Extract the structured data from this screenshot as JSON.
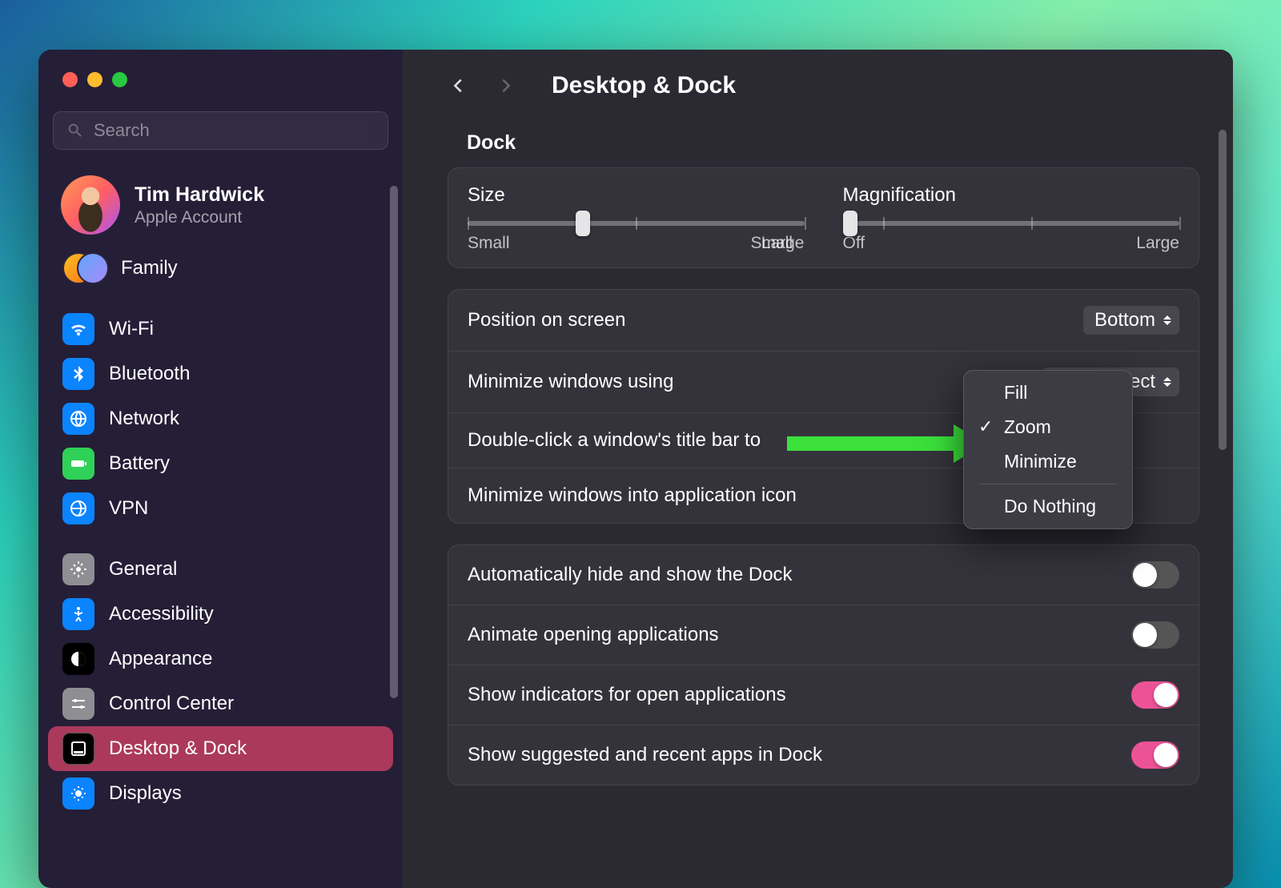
{
  "window": {
    "title": "Desktop & Dock",
    "search_placeholder": "Search"
  },
  "account": {
    "name": "Tim Hardwick",
    "subtitle": "Apple Account",
    "family_label": "Family"
  },
  "sidebar_groups": [
    {
      "items": [
        {
          "key": "wifi",
          "label": "Wi-Fi",
          "icon": "wifi"
        },
        {
          "key": "bluetooth",
          "label": "Bluetooth",
          "icon": "bt"
        },
        {
          "key": "network",
          "label": "Network",
          "icon": "net"
        },
        {
          "key": "battery",
          "label": "Battery",
          "icon": "bat"
        },
        {
          "key": "vpn",
          "label": "VPN",
          "icon": "vpn"
        }
      ]
    },
    {
      "items": [
        {
          "key": "general",
          "label": "General",
          "icon": "gen"
        },
        {
          "key": "accessibility",
          "label": "Accessibility",
          "icon": "acc"
        },
        {
          "key": "appearance",
          "label": "Appearance",
          "icon": "app"
        },
        {
          "key": "control-center",
          "label": "Control Center",
          "icon": "cc"
        },
        {
          "key": "desktop-dock",
          "label": "Desktop & Dock",
          "icon": "dd",
          "selected": true
        },
        {
          "key": "displays",
          "label": "Displays",
          "icon": "disp"
        }
      ]
    }
  ],
  "dock": {
    "section_title": "Dock",
    "size_label": "Size",
    "magnification_label": "Magnification",
    "small": "Small",
    "large": "Large",
    "off": "Off",
    "position_label": "Position on screen",
    "position_value": "Bottom",
    "minimize_using_label": "Minimize windows using",
    "minimize_using_value": "Scale Effect",
    "doubleclick_label": "Double-click a window's title bar to",
    "minimize_into_label": "Minimize windows into application icon",
    "auto_hide_label": "Automatically hide and show the Dock",
    "auto_hide_on": false,
    "animate_label": "Animate opening applications",
    "animate_on": false,
    "indicators_label": "Show indicators for open applications",
    "indicators_on": true,
    "suggested_label": "Show suggested and recent apps in Dock",
    "suggested_on": true
  },
  "popup": {
    "items": [
      "Fill",
      "Zoom",
      "Minimize"
    ],
    "divider_after": 2,
    "extra": "Do Nothing",
    "selected": "Zoom"
  }
}
